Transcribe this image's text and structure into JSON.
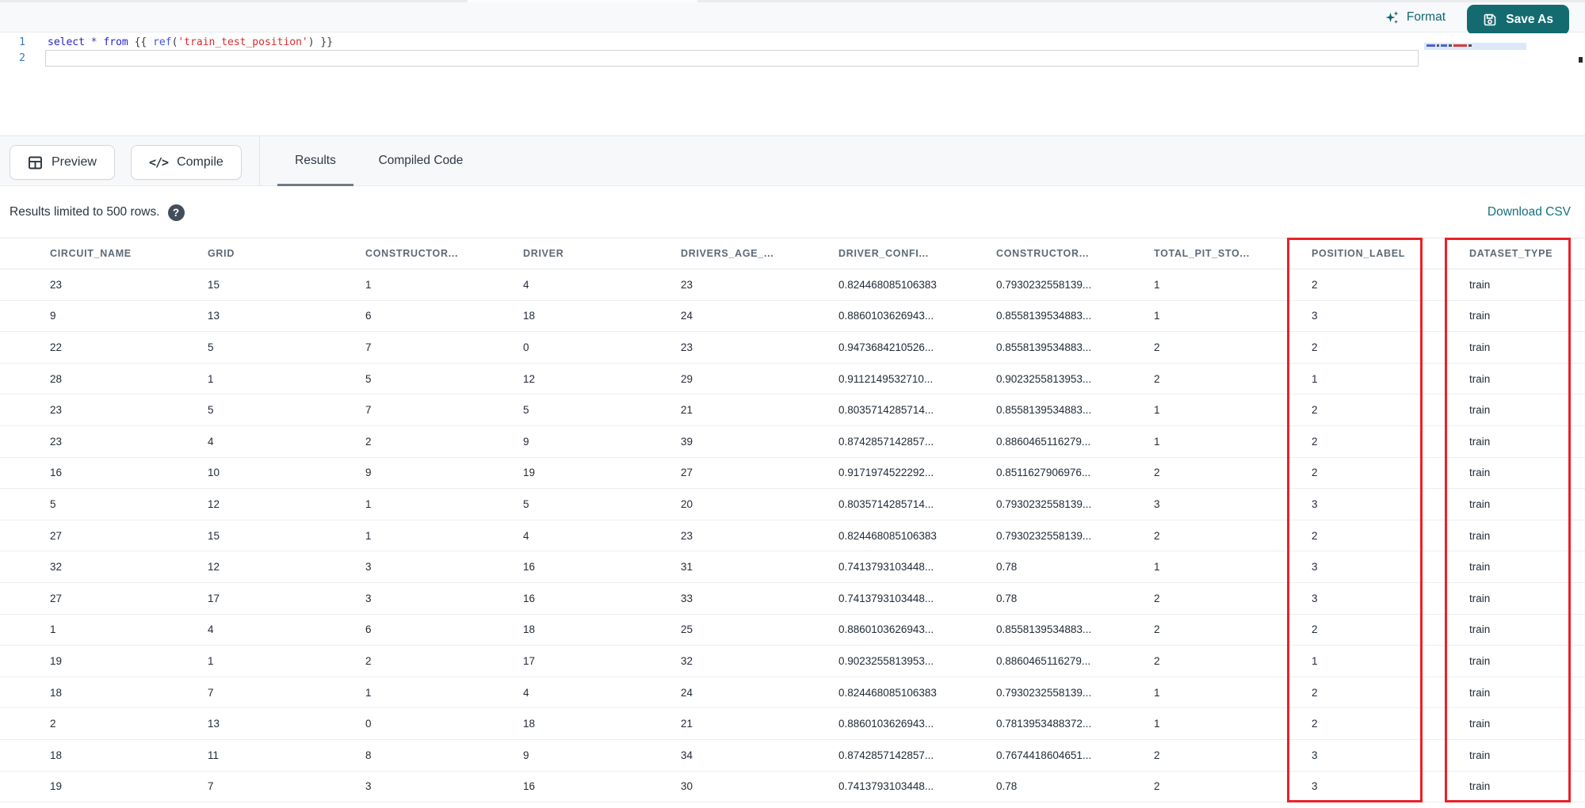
{
  "top_toolbar": {
    "format_label": "Format",
    "save_as_label": "Save As"
  },
  "editor": {
    "line_numbers": [
      "1",
      "2"
    ],
    "code_line_tokens": [
      {
        "text": "select",
        "type": "keyword"
      },
      {
        "text": " ",
        "type": "plain"
      },
      {
        "text": "*",
        "type": "operator"
      },
      {
        "text": " ",
        "type": "plain"
      },
      {
        "text": "from",
        "type": "keyword"
      },
      {
        "text": " {{ ",
        "type": "plain"
      },
      {
        "text": "ref",
        "type": "function"
      },
      {
        "text": "(",
        "type": "plain"
      },
      {
        "text": "'train_test_position'",
        "type": "string"
      },
      {
        "text": ")",
        "type": "plain"
      },
      {
        "text": " }}",
        "type": "plain"
      }
    ]
  },
  "actions": {
    "preview_label": "Preview",
    "compile_label": "Compile"
  },
  "tabs": [
    {
      "label": "Results",
      "active": true
    },
    {
      "label": "Compiled Code",
      "active": false
    }
  ],
  "results_bar": {
    "limit_text": "Results limited to 500 rows.",
    "download_csv_label": "Download CSV"
  },
  "table": {
    "columns": [
      "CIRCUIT_NAME",
      "GRID",
      "CONSTRUCTOR...",
      "DRIVER",
      "DRIVERS_AGE_...",
      "DRIVER_CONFI...",
      "CONSTRUCTOR...",
      "TOTAL_PIT_STO...",
      "POSITION_LABEL",
      "DATASET_TYPE"
    ],
    "rows": [
      [
        "23",
        "15",
        "1",
        "4",
        "23",
        "0.824468085106383",
        "0.7930232558139...",
        "1",
        "2",
        "train"
      ],
      [
        "9",
        "13",
        "6",
        "18",
        "24",
        "0.8860103626943...",
        "0.8558139534883...",
        "1",
        "3",
        "train"
      ],
      [
        "22",
        "5",
        "7",
        "0",
        "23",
        "0.9473684210526...",
        "0.8558139534883...",
        "2",
        "2",
        "train"
      ],
      [
        "28",
        "1",
        "5",
        "12",
        "29",
        "0.9112149532710...",
        "0.9023255813953...",
        "2",
        "1",
        "train"
      ],
      [
        "23",
        "5",
        "7",
        "5",
        "21",
        "0.8035714285714...",
        "0.8558139534883...",
        "1",
        "2",
        "train"
      ],
      [
        "23",
        "4",
        "2",
        "9",
        "39",
        "0.8742857142857...",
        "0.8860465116279...",
        "1",
        "2",
        "train"
      ],
      [
        "16",
        "10",
        "9",
        "19",
        "27",
        "0.9171974522292...",
        "0.8511627906976...",
        "2",
        "2",
        "train"
      ],
      [
        "5",
        "12",
        "1",
        "5",
        "20",
        "0.8035714285714...",
        "0.7930232558139...",
        "3",
        "3",
        "train"
      ],
      [
        "27",
        "15",
        "1",
        "4",
        "23",
        "0.824468085106383",
        "0.7930232558139...",
        "2",
        "2",
        "train"
      ],
      [
        "32",
        "12",
        "3",
        "16",
        "31",
        "0.7413793103448...",
        "0.78",
        "1",
        "3",
        "train"
      ],
      [
        "27",
        "17",
        "3",
        "16",
        "33",
        "0.7413793103448...",
        "0.78",
        "2",
        "3",
        "train"
      ],
      [
        "1",
        "4",
        "6",
        "18",
        "25",
        "0.8860103626943...",
        "0.8558139534883...",
        "2",
        "2",
        "train"
      ],
      [
        "19",
        "1",
        "2",
        "17",
        "32",
        "0.9023255813953...",
        "0.8860465116279...",
        "2",
        "1",
        "train"
      ],
      [
        "18",
        "7",
        "1",
        "4",
        "24",
        "0.824468085106383",
        "0.7930232558139...",
        "1",
        "2",
        "train"
      ],
      [
        "2",
        "13",
        "0",
        "18",
        "21",
        "0.8860103626943...",
        "0.7813953488372...",
        "1",
        "2",
        "train"
      ],
      [
        "18",
        "11",
        "8",
        "9",
        "34",
        "0.8742857142857...",
        "0.7674418604651...",
        "2",
        "3",
        "train"
      ],
      [
        "19",
        "7",
        "3",
        "16",
        "30",
        "0.7413793103448...",
        "0.78",
        "2",
        "3",
        "train"
      ]
    ],
    "highlighted_columns": [
      "POSITION_LABEL",
      "DATASET_TYPE"
    ],
    "highlight_color": "#ea2127"
  },
  "colors": {
    "accent_teal": "#136b70",
    "link_teal": "#147082",
    "highlight_red": "#ea2127"
  }
}
